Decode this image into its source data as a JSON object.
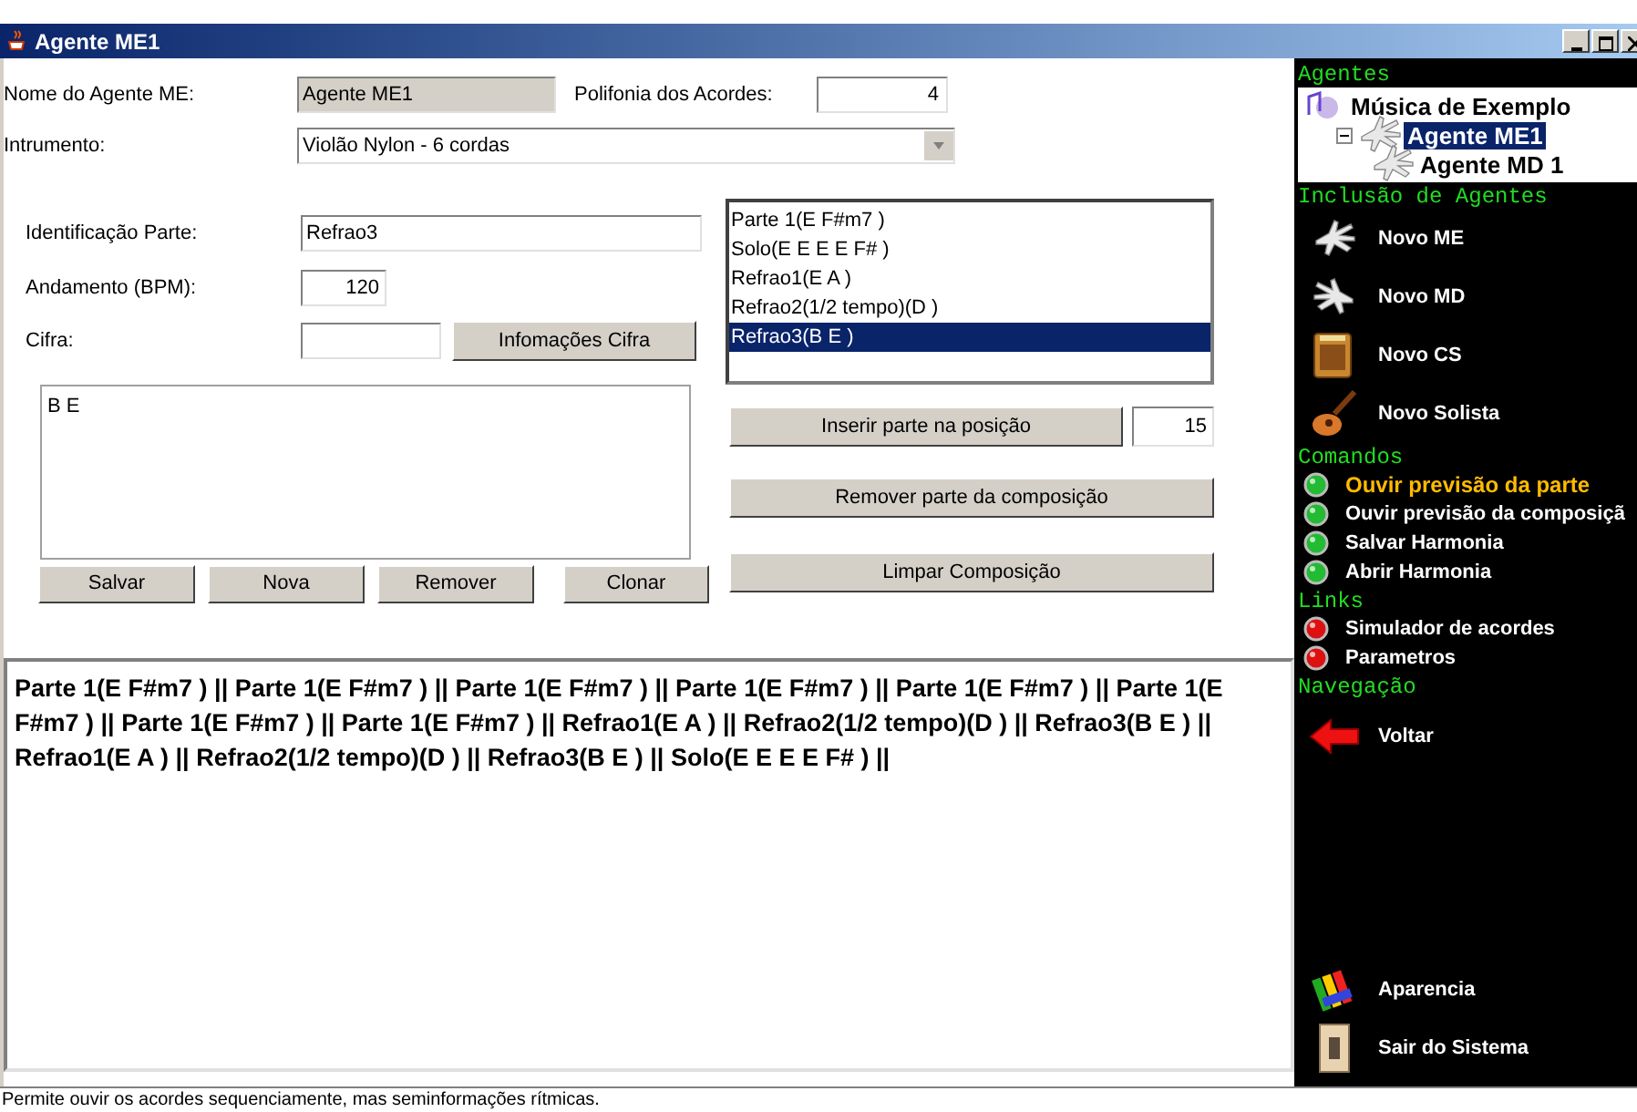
{
  "window": {
    "title": "Agente ME1"
  },
  "agent": {
    "name_label": "Nome do Agente ME:",
    "name_value": "Agente ME1",
    "polyphony_label": "Polifonia dos Acordes:",
    "polyphony_value": "4",
    "instrument_label": "Intrumento:",
    "instrument_value": "Violão Nylon - 6 cordas"
  },
  "part": {
    "id_label": "Identificação Parte:",
    "id_value": "Refrao3",
    "tempo_label": "Andamento (BPM):",
    "tempo_value": "120",
    "chord_label": "Cifra:",
    "chord_info_button": "Infomações Cifra",
    "chords_text": "B E"
  },
  "part_buttons": [
    "Salvar",
    "Nova",
    "Remover",
    "Clonar"
  ],
  "parts_list": [
    {
      "label": "Parte 1(E F#m7 )",
      "selected": false
    },
    {
      "label": "Solo(E E E E F# )",
      "selected": false
    },
    {
      "label": "Refrao1(E A )",
      "selected": false
    },
    {
      "label": "Refrao2(1/2 tempo)(D )",
      "selected": false
    },
    {
      "label": "Refrao3(B E )",
      "selected": true
    }
  ],
  "insert_button": "Inserir parte na posição",
  "position_value": "15",
  "remove_button": "Remover parte da composição",
  "clear_button": "Limpar Composição",
  "composition_text": "Parte 1(E F#m7 ) || Parte 1(E F#m7 ) || Parte 1(E F#m7 ) || Parte 1(E F#m7 ) || Parte 1(E F#m7 ) || Parte 1(E F#m7 ) || Parte 1(E F#m7 ) || Parte 1(E F#m7 ) || Refrao1(E A ) || Refrao2(1/2 tempo)(D ) || Refrao3(B E ) || Refrao1(E A ) || Refrao2(1/2 tempo)(D ) || Refrao3(B E ) || Solo(E E E E F# ) ||",
  "sidebar": {
    "tree_title": "Agentes",
    "tree": [
      {
        "label": "Música de Exemplo",
        "selected": false,
        "children": [
          {
            "label": "Agente ME1",
            "selected": true,
            "expanded": true,
            "children": [
              {
                "label": "Agente MD 1",
                "selected": false
              }
            ]
          }
        ]
      }
    ],
    "sections": [
      {
        "title": "Inclusão de Agentes",
        "items": [
          {
            "label": "Novo ME",
            "kind": "lefthand",
            "selected": false
          },
          {
            "label": "Novo MD",
            "kind": "righthand",
            "selected": false
          },
          {
            "label": "Novo CS",
            "kind": "amplifier",
            "selected": false
          },
          {
            "label": "Novo Solista",
            "kind": "guitar",
            "selected": false
          }
        ]
      },
      {
        "title": "Comandos",
        "items": [
          {
            "label": "Ouvir previsão da parte",
            "kind": "command",
            "selected": true
          },
          {
            "label": "Ouvir previsão da composiçã",
            "kind": "command",
            "selected": false
          },
          {
            "label": "Salvar Harmonia",
            "kind": "command",
            "selected": false
          },
          {
            "label": "Abrir Harmonia",
            "kind": "command",
            "selected": false
          }
        ]
      },
      {
        "title": "Links",
        "items": [
          {
            "label": "Simulador de acordes",
            "kind": "link",
            "selected": false
          },
          {
            "label": "Parametros",
            "kind": "link",
            "selected": false
          }
        ]
      },
      {
        "title": "Navegação",
        "items": [
          {
            "label": "Voltar",
            "kind": "back",
            "selected": false
          }
        ]
      }
    ],
    "footer": [
      {
        "label": "Aparencia",
        "kind": "appearance",
        "selected": false
      },
      {
        "label": "Sair do Sistema",
        "kind": "exit",
        "selected": false
      }
    ]
  },
  "status_bar": "Permite ouvir os acordes sequenciamente, mas seminformações rítmicas."
}
